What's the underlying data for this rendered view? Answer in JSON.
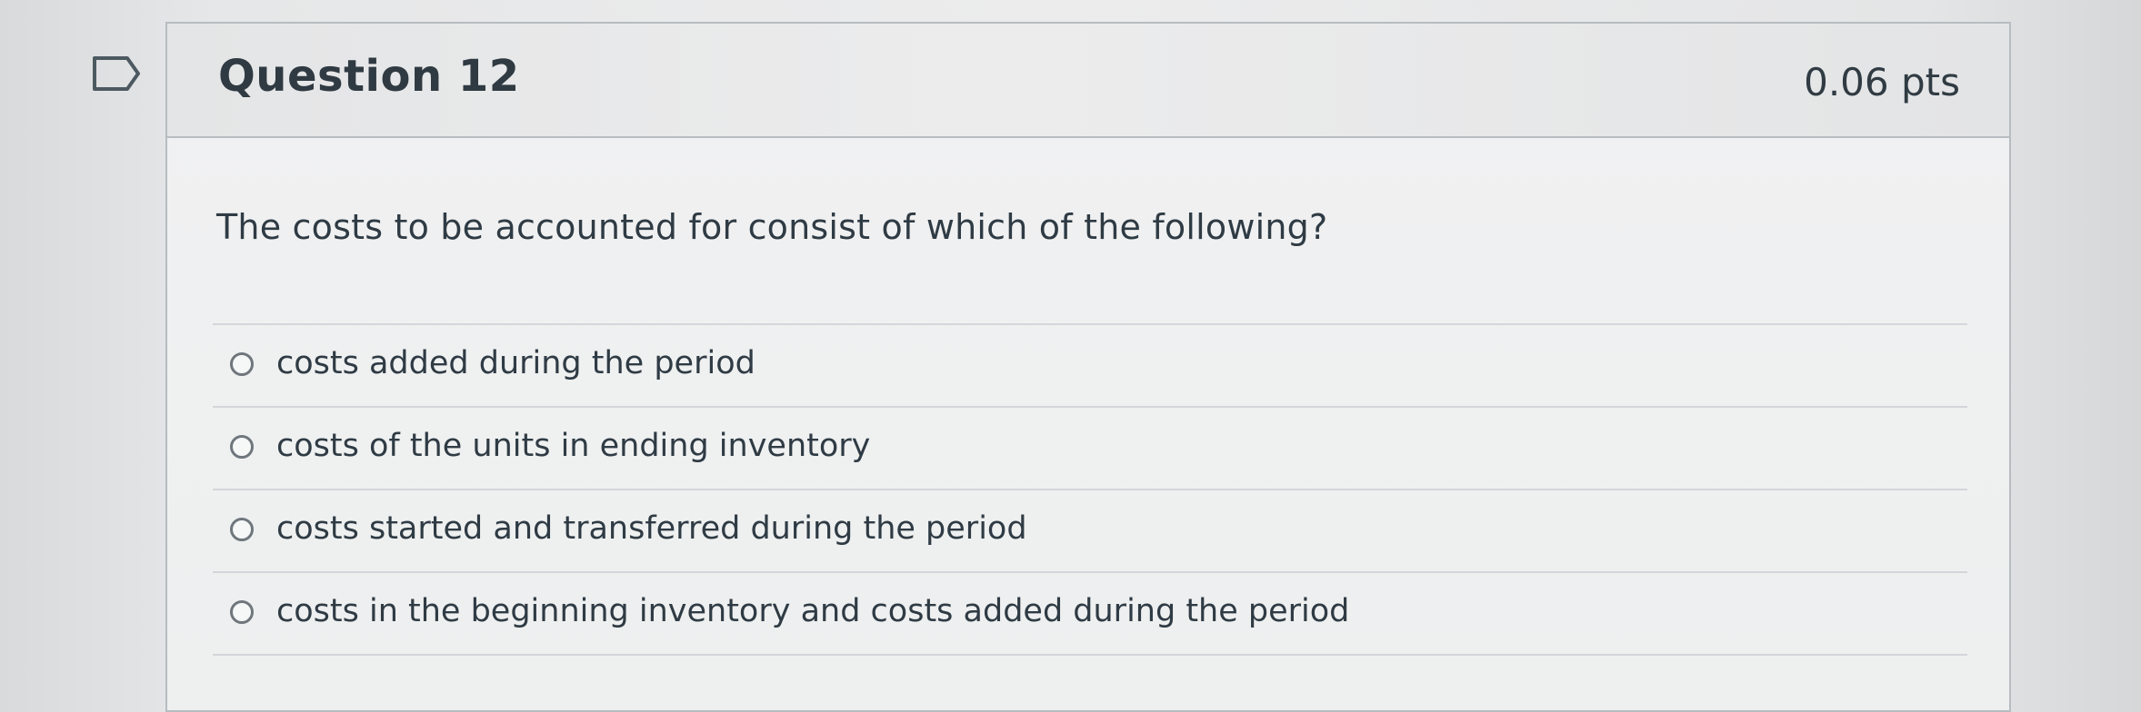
{
  "question": {
    "title": "Question 12",
    "points": "0.06 pts",
    "text": "The costs to be accounted for consist of which of the following?",
    "answers": [
      "costs added during the period",
      "costs of the units in ending inventory",
      "costs started and transferred during the period",
      "costs in the beginning inventory and costs added during the period"
    ]
  },
  "icons": {
    "flag": "flag-icon",
    "radio": "radio-unselected-icon"
  },
  "colors": {
    "background": "#e6e7e8",
    "header": "#e8e9ea",
    "border": "#b7bcc0",
    "text": "#2f3b44"
  }
}
